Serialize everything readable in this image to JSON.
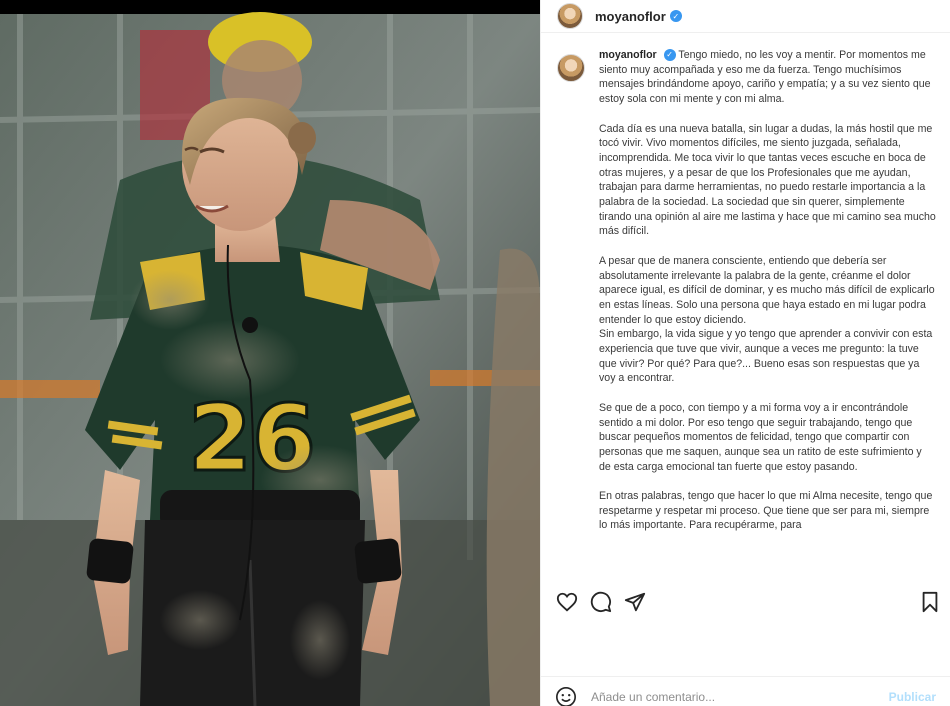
{
  "post": {
    "username": "moyanoflor",
    "verified_icon": "verified-badge-icon",
    "caption": [
      "Tengo miedo, no les voy a mentir. Por momentos me siento muy acompañada y eso me da fuerza. Tengo muchísimos mensajes brindándome apoyo, cariño y empatía; y a su vez siento que estoy sola con mi mente y con mi alma.",
      "Cada día es una nueva batalla, sin lugar a dudas, la más hostil que me tocó vivir. Vivo momentos difíciles, me siento juzgada, señalada, incomprendida. Me toca vivir lo que tantas veces escuche en boca de otras mujeres, y a pesar de que los Profesionales que me ayudan, trabajan para darme herramientas, no puedo restarle importancia a la palabra de la sociedad. La sociedad que sin querer, simplemente tirando una opinión al aire me lastima y hace que mi camino sea mucho más difícil.",
      "A pesar que de manera consciente, entiendo que debería ser absolutamente irrelevante la palabra de la gente, créanme el dolor aparece igual, es difícil de dominar, y es mucho más difícil de explicarlo en estas líneas. Solo una persona que haya estado en mi lugar podra entender lo que estoy diciendo.",
      "Sin embargo, la vida sigue y yo tengo que aprender a convivir con esta experiencia que tuve que vivir, aunque a veces me pregunto: la tuve que vivir? Por qué? Para que?... Bueno esas son respuestas que ya voy a encontrar.",
      "Se que de a poco, con tiempo y a mi forma voy a ir encontrándole sentido a mi dolor. Por eso tengo que seguir trabajando, tengo que buscar pequeños momentos de felicidad, tengo que compartir con personas que me saquen, aunque sea un ratito de este sufrimiento y de esta carga emocional tan fuerte que estoy pasando.",
      "En otras palabras, tengo que hacer lo que mi Alma necesite, tengo que respetarme y respetar mi proceso. Que tiene que ser para mi, siempre lo más importante. Para recupérarme, para"
    ],
    "photo": {
      "jersey_number": "26"
    }
  },
  "actions": {
    "like_icon": "heart-icon",
    "comment_icon": "comment-icon",
    "share_icon": "share-icon",
    "save_icon": "bookmark-icon"
  },
  "comment": {
    "placeholder": "Añade un comentario...",
    "publish_label": "Publicar"
  },
  "colors": {
    "verified": "#3897f0",
    "publish_disabled": "#b2dffc",
    "jersey_green": "#1f3a2c",
    "jersey_gold": "#d8b433"
  }
}
